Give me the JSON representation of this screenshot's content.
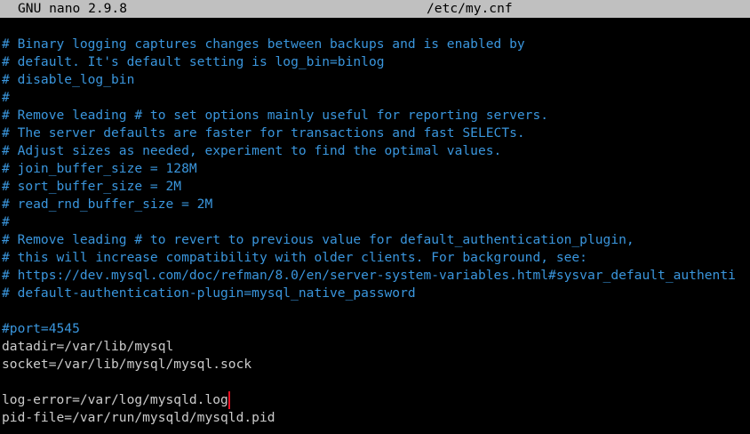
{
  "titlebar": {
    "app": "GNU nano 2.9.8",
    "filename": "/etc/my.cnf"
  },
  "colors": {
    "comment": "#3a96dd",
    "text": "#cccccc",
    "titlebar_bg": "#c0c0c0",
    "highlight": "#e81123"
  },
  "lines": [
    "# Binary logging captures changes between backups and is enabled by",
    "# default. It's default setting is log_bin=binlog",
    "# disable_log_bin",
    "#",
    "# Remove leading # to set options mainly useful for reporting servers.",
    "# The server defaults are faster for transactions and fast SELECTs.",
    "# Adjust sizes as needed, experiment to find the optimal values.",
    "# join_buffer_size = 128M",
    "# sort_buffer_size = 2M",
    "# read_rnd_buffer_size = 2M",
    "#",
    "# Remove leading # to revert to previous value for default_authentication_plugin,",
    "# this will increase compatibility with older clients. For background, see:",
    "# https://dev.mysql.com/doc/refman/8.0/en/server-system-variables.html#sysvar_default_authenti",
    "# default-authentication-plugin=mysql_native_password",
    "",
    "#port=4545",
    "datadir=/var/lib/mysql",
    "socket=/var/lib/mysql/mysql.sock",
    "",
    "log-error=/var/log/mysqld.log",
    "pid-file=/var/run/mysqld/mysqld.pid"
  ]
}
